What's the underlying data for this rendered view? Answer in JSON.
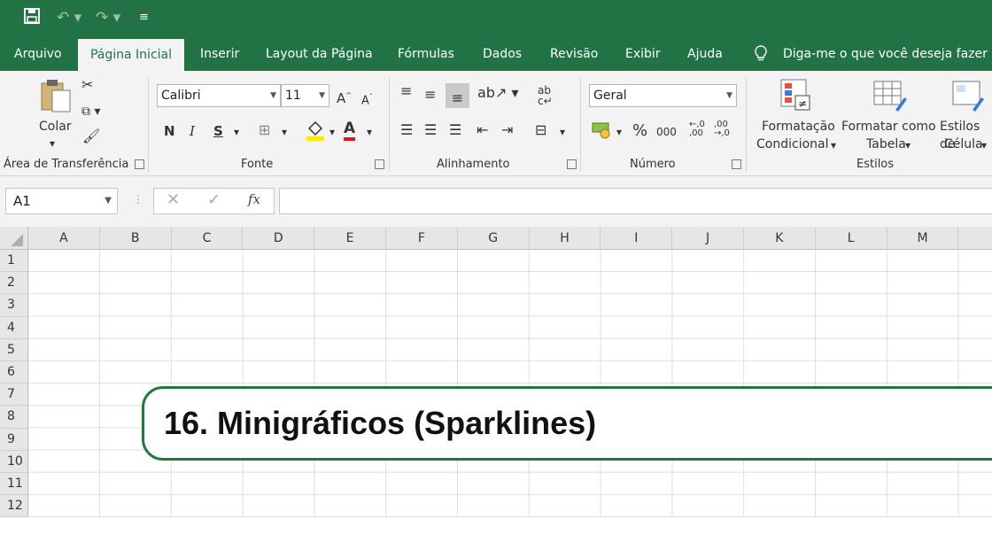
{
  "ribbon_tabs": [
    "Arquivo",
    "Página Inicial",
    "Inserir",
    "Layout da Página",
    "Fórmulas",
    "Dados",
    "Revisão",
    "Exibir",
    "Ajuda"
  ],
  "tell_me": "Diga-me o que você deseja fazer",
  "clipboard": {
    "paste_label": "Colar",
    "group_label": "Área de Transferência"
  },
  "font": {
    "name": "Calibri",
    "size": "11",
    "bold": "N",
    "italic": "I",
    "underline": "S",
    "group_label": "Fonte"
  },
  "alignment": {
    "group_label": "Alinhamento"
  },
  "number": {
    "format": "Geral",
    "percent": "%",
    "thousands": "000",
    "group_label": "Número"
  },
  "styles": {
    "conditional_line1": "Formatação",
    "conditional_line2": "Condicional",
    "table_line1": "Formatar como",
    "table_line2": "Tabela",
    "cell_line1": "Estilos de",
    "cell_line2": "Célula",
    "group_label": "Estilos"
  },
  "formula_bar": {
    "name_box": "A1",
    "fx": "fx"
  },
  "columns": [
    "A",
    "B",
    "C",
    "D",
    "E",
    "F",
    "G",
    "H",
    "I",
    "J",
    "K",
    "L",
    "M"
  ],
  "rows": [
    "1",
    "2",
    "3",
    "4",
    "5",
    "6",
    "7",
    "8",
    "9",
    "10",
    "11",
    "12"
  ],
  "banner": {
    "title": "16. Minigráficos (Sparklines)"
  },
  "colors": {
    "excel_green": "#217346",
    "banner_border": "#1f7a3e"
  }
}
